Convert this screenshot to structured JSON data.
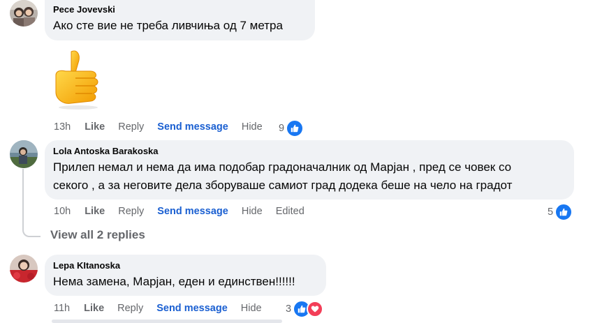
{
  "comments": [
    {
      "author": "Pece Jovevski",
      "text": "Ако сте вие не треба ливчиња од 7 метра",
      "sticker": "thumbs-up-sticker",
      "time": "13h",
      "like": "Like",
      "reply": "Reply",
      "send_message": "Send message",
      "hide": "Hide",
      "reaction_count": "9",
      "reactions": [
        "like-icon"
      ]
    },
    {
      "author": "Lola Antoska Barakoska",
      "text_line1": "Прилеп немал и нема да има подобар градоначалник од Марјан , пред се човек со",
      "text_line2": "секого , а за неговите дела зборуваше самиот град додека беше на чело на градот",
      "time": "10h",
      "like": "Like",
      "reply": "Reply",
      "send_message": "Send message",
      "hide": "Hide",
      "edited": "Edited",
      "reaction_count": "5",
      "reactions": [
        "like-icon"
      ]
    },
    {
      "author": "Lepa KItanoska",
      "text": "Нема замена, Марјан, еден и единствен!!!!!!",
      "time": "11h",
      "like": "Like",
      "reply": "Reply",
      "send_message": "Send message",
      "hide": "Hide",
      "reaction_count": "3",
      "reactions": [
        "like-icon",
        "love-icon"
      ]
    }
  ],
  "view_replies": "View all 2 replies",
  "colors": {
    "bubble": "#f0f2f5",
    "link": "#1a5fd1",
    "meta": "#65676b",
    "like": "#1877f2",
    "love": "#f33e58"
  }
}
